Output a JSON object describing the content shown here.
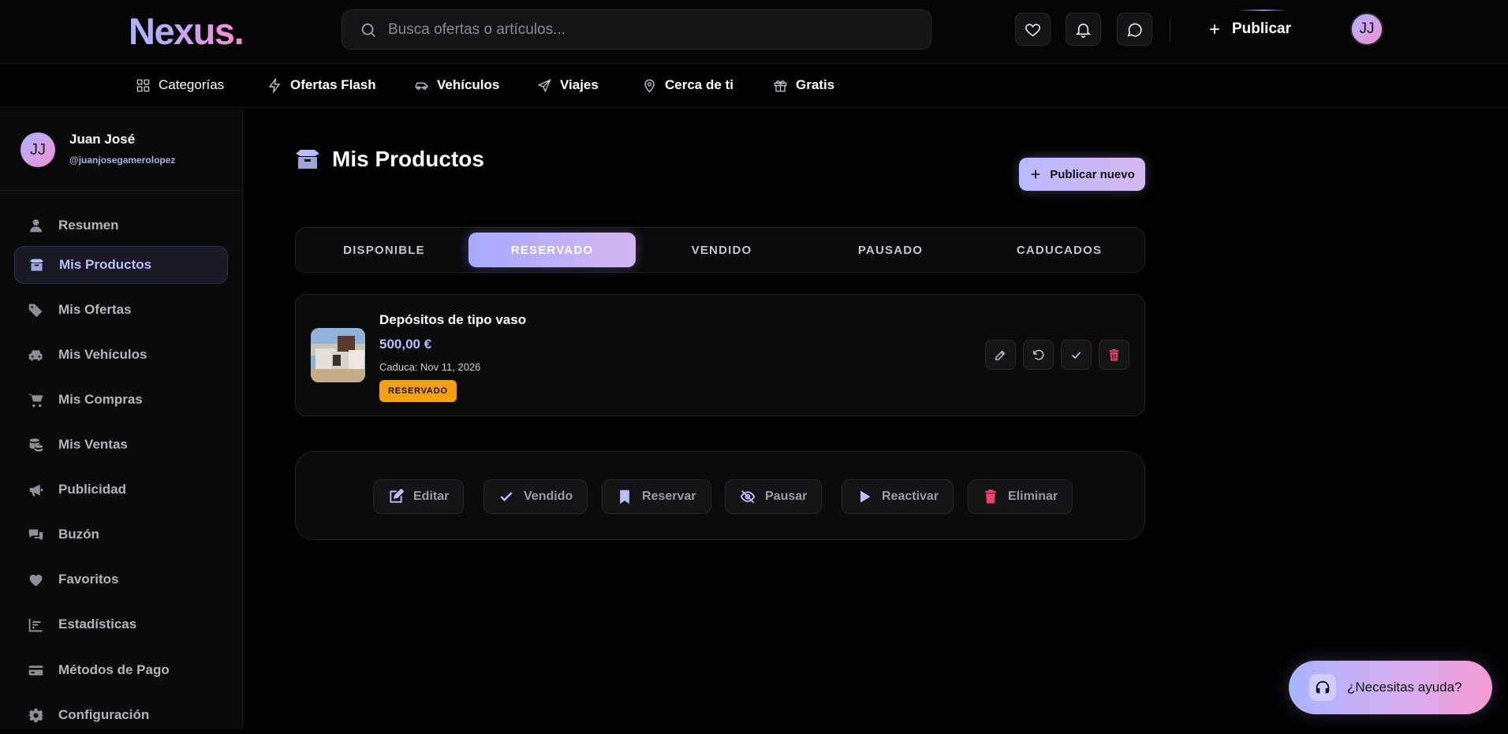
{
  "header": {
    "logo_text": "Nexus",
    "logo_dot": ".",
    "search_placeholder": "Busca ofertas o artículos...",
    "publish_label": "Publicar",
    "avatar_initials": "JJ"
  },
  "category_nav": {
    "items": [
      {
        "label": "Categorías",
        "icon": "grid-icon"
      },
      {
        "label": "Ofertas Flash",
        "icon": "lightning-icon"
      },
      {
        "label": "Vehículos",
        "icon": "car-icon"
      },
      {
        "label": "Viajes",
        "icon": "plane-icon"
      },
      {
        "label": "Cerca de ti",
        "icon": "location-pin-icon"
      },
      {
        "label": "Gratis",
        "icon": "gift-icon"
      }
    ]
  },
  "sidebar": {
    "user": {
      "initials": "JJ",
      "name": "Juan José",
      "handle": "@juanjosegamerolopez"
    },
    "items": [
      {
        "label": "Resumen",
        "icon": "user-icon"
      },
      {
        "label": "Mis Productos",
        "icon": "box-icon",
        "active": true
      },
      {
        "label": "Mis Ofertas",
        "icon": "tags-icon"
      },
      {
        "label": "Mis Vehículos",
        "icon": "car-icon"
      },
      {
        "label": "Mis Compras",
        "icon": "cart-icon"
      },
      {
        "label": "Mis Ventas",
        "icon": "coins-icon"
      },
      {
        "label": "Publicidad",
        "icon": "megaphone-icon"
      },
      {
        "label": "Buzón",
        "icon": "chat-icon"
      },
      {
        "label": "Favoritos",
        "icon": "heart-icon"
      },
      {
        "label": "Estadísticas",
        "icon": "chart-icon"
      },
      {
        "label": "Métodos de Pago",
        "icon": "credit-card-icon"
      },
      {
        "label": "Configuración",
        "icon": "gear-icon"
      }
    ]
  },
  "main": {
    "title": "Mis Productos",
    "publish_new_label": "Publicar nuevo",
    "tabs": [
      {
        "label": "DISPONIBLE",
        "active": false
      },
      {
        "label": "RESERVADO",
        "active": true
      },
      {
        "label": "VENDIDO",
        "active": false
      },
      {
        "label": "PAUSADO",
        "active": false
      },
      {
        "label": "CADUCADOS",
        "active": false
      }
    ],
    "product": {
      "title": "Depósitos de tipo vaso",
      "price": "500,00 €",
      "expires": "Caduca: Nov 11, 2026",
      "status": "RESERVADO"
    },
    "bulk_actions": [
      {
        "label": "Editar",
        "icon": "edit-icon"
      },
      {
        "label": "Vendido",
        "icon": "check-icon"
      },
      {
        "label": "Reservar",
        "icon": "bookmark-icon"
      },
      {
        "label": "Pausar",
        "icon": "eye-slash-icon"
      },
      {
        "label": "Reactivar",
        "icon": "play-icon"
      },
      {
        "label": "Eliminar",
        "icon": "trash-icon"
      }
    ]
  },
  "help": {
    "label": "¿Necesitas ayuda?"
  },
  "colors": {
    "accent": "#b7bfff",
    "accent_pink": "#f58fd0",
    "badge_reserved": "#f5a00e",
    "danger": "#f0406a"
  }
}
